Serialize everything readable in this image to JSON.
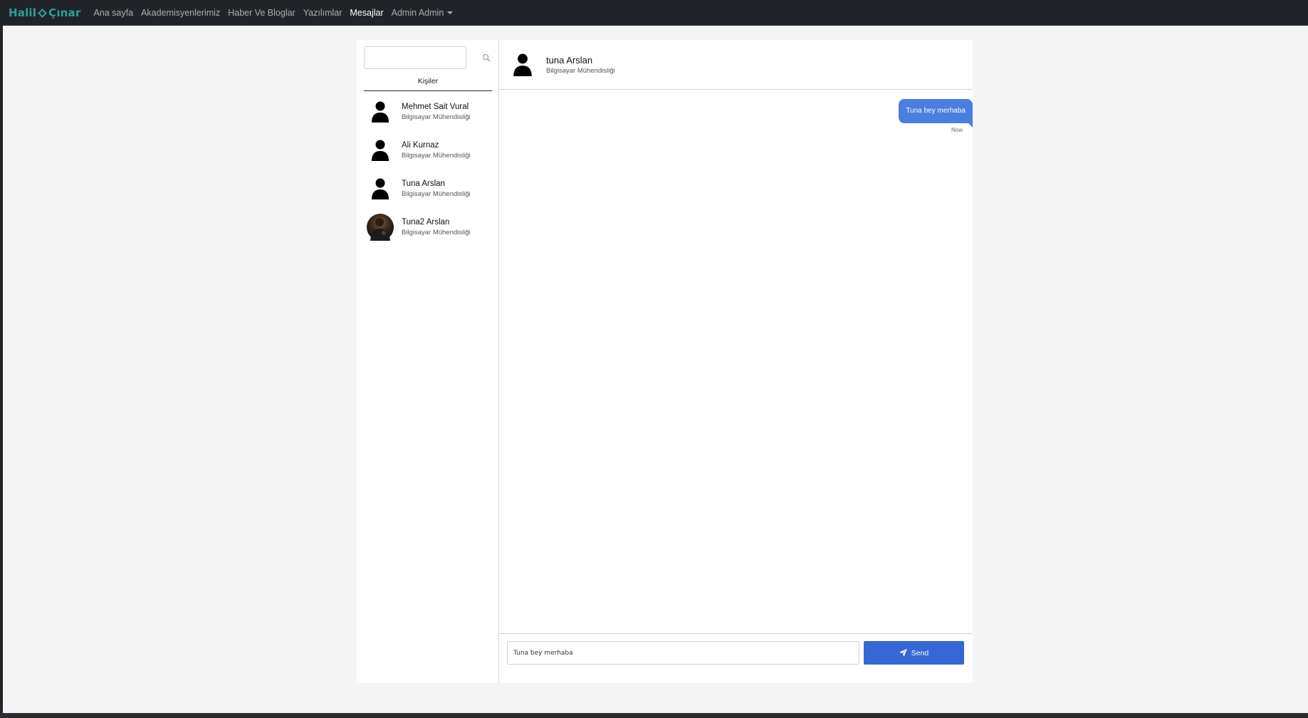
{
  "navbar": {
    "brand_left": "Halil",
    "brand_right": "Çınar",
    "links": [
      "Ana sayfa",
      "Akademisyenlerimiz",
      "Haber Ve Bloglar",
      "Yazılımlar",
      "Mesajlar"
    ],
    "active": "Mesajlar",
    "user_menu": "Admin Admin"
  },
  "sidebar": {
    "search": {
      "value": "",
      "placeholder": ""
    },
    "header": "Kişiler",
    "contacts": [
      {
        "name": "Mehmet Sait Vural",
        "dept": "Bilgisayar Mühendisliği",
        "avatar": "person-icon"
      },
      {
        "name": "Ali Kurnaz",
        "dept": "Bilgisayar Mühendisliği",
        "avatar": "person-icon"
      },
      {
        "name": "Tuna Arslan",
        "dept": "Bilgisayar Mühendisliği",
        "avatar": "person-icon"
      },
      {
        "name": "Tuna2 Arslan",
        "dept": "Bilgisayar Mühendisliği",
        "avatar": "photo"
      }
    ]
  },
  "chat": {
    "title": "tuna Arslan",
    "subtitle": "Bilgisayar Mühendisliği",
    "messages": [
      {
        "text": "Tuna bey merhaba",
        "time": "Now",
        "sent": true
      }
    ],
    "input_value": "Tuna bey merhaba",
    "send_label": "Send"
  },
  "colors": {
    "navbar": "#212529",
    "brand": "#2aa198",
    "accent": "#3567d6",
    "bubble": "#4a7fe0"
  }
}
